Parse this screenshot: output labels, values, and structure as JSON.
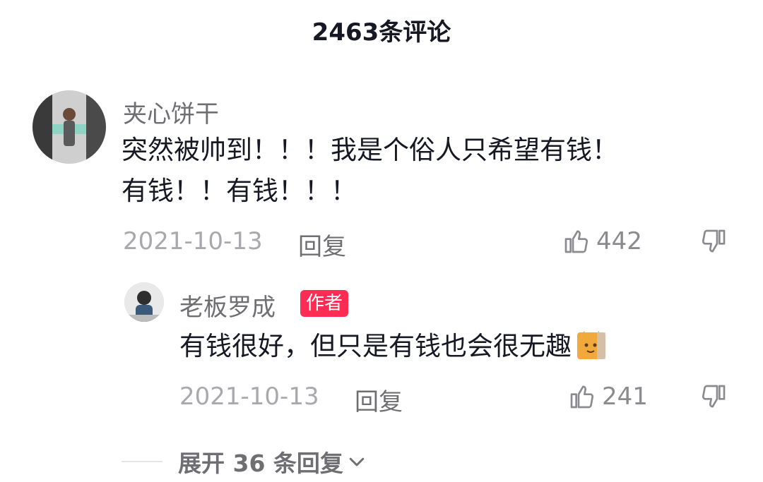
{
  "header": {
    "title": "2463条评论"
  },
  "comments": [
    {
      "username": "夹心饼干",
      "text_line1": "突然被帅到！！！我是个俗人只希望有钱！",
      "text_line2": "有钱！！有钱！！！",
      "date": "2021-10-13",
      "reply_label": "回复",
      "likes": "442",
      "avatar_icon": "user-avatar-photo"
    }
  ],
  "reply": {
    "username": "老板罗成",
    "badge": "作者",
    "text": "有钱很好，但只是有钱也会很无趣",
    "emoji": "cat-emoji",
    "date": "2021-10-13",
    "reply_label": "回复",
    "likes": "241",
    "avatar_icon": "author-avatar-photo"
  },
  "expand": {
    "label": "展开 36 条回复"
  },
  "colors": {
    "author_badge": "#fe2c55",
    "secondary_text": "#a8a8ad",
    "primary_text": "#161823"
  }
}
